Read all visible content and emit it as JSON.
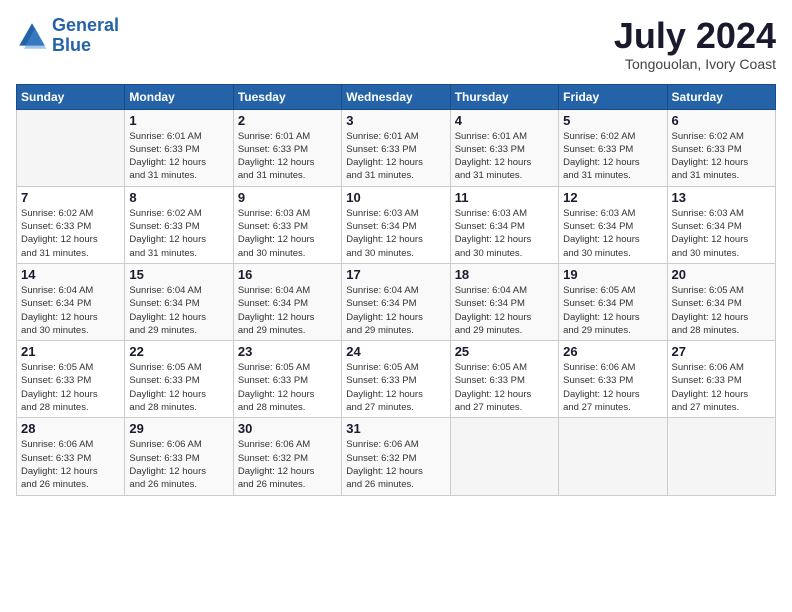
{
  "header": {
    "logo_line1": "General",
    "logo_line2": "Blue",
    "month_title": "July 2024",
    "subtitle": "Tongouolan, Ivory Coast"
  },
  "days_of_week": [
    "Sunday",
    "Monday",
    "Tuesday",
    "Wednesday",
    "Thursday",
    "Friday",
    "Saturday"
  ],
  "weeks": [
    [
      {
        "day": "",
        "info": ""
      },
      {
        "day": "1",
        "info": "Sunrise: 6:01 AM\nSunset: 6:33 PM\nDaylight: 12 hours\nand 31 minutes."
      },
      {
        "day": "2",
        "info": "Sunrise: 6:01 AM\nSunset: 6:33 PM\nDaylight: 12 hours\nand 31 minutes."
      },
      {
        "day": "3",
        "info": "Sunrise: 6:01 AM\nSunset: 6:33 PM\nDaylight: 12 hours\nand 31 minutes."
      },
      {
        "day": "4",
        "info": "Sunrise: 6:01 AM\nSunset: 6:33 PM\nDaylight: 12 hours\nand 31 minutes."
      },
      {
        "day": "5",
        "info": "Sunrise: 6:02 AM\nSunset: 6:33 PM\nDaylight: 12 hours\nand 31 minutes."
      },
      {
        "day": "6",
        "info": "Sunrise: 6:02 AM\nSunset: 6:33 PM\nDaylight: 12 hours\nand 31 minutes."
      }
    ],
    [
      {
        "day": "7",
        "info": "Sunrise: 6:02 AM\nSunset: 6:33 PM\nDaylight: 12 hours\nand 31 minutes."
      },
      {
        "day": "8",
        "info": "Sunrise: 6:02 AM\nSunset: 6:33 PM\nDaylight: 12 hours\nand 31 minutes."
      },
      {
        "day": "9",
        "info": "Sunrise: 6:03 AM\nSunset: 6:33 PM\nDaylight: 12 hours\nand 30 minutes."
      },
      {
        "day": "10",
        "info": "Sunrise: 6:03 AM\nSunset: 6:34 PM\nDaylight: 12 hours\nand 30 minutes."
      },
      {
        "day": "11",
        "info": "Sunrise: 6:03 AM\nSunset: 6:34 PM\nDaylight: 12 hours\nand 30 minutes."
      },
      {
        "day": "12",
        "info": "Sunrise: 6:03 AM\nSunset: 6:34 PM\nDaylight: 12 hours\nand 30 minutes."
      },
      {
        "day": "13",
        "info": "Sunrise: 6:03 AM\nSunset: 6:34 PM\nDaylight: 12 hours\nand 30 minutes."
      }
    ],
    [
      {
        "day": "14",
        "info": "Sunrise: 6:04 AM\nSunset: 6:34 PM\nDaylight: 12 hours\nand 30 minutes."
      },
      {
        "day": "15",
        "info": "Sunrise: 6:04 AM\nSunset: 6:34 PM\nDaylight: 12 hours\nand 29 minutes."
      },
      {
        "day": "16",
        "info": "Sunrise: 6:04 AM\nSunset: 6:34 PM\nDaylight: 12 hours\nand 29 minutes."
      },
      {
        "day": "17",
        "info": "Sunrise: 6:04 AM\nSunset: 6:34 PM\nDaylight: 12 hours\nand 29 minutes."
      },
      {
        "day": "18",
        "info": "Sunrise: 6:04 AM\nSunset: 6:34 PM\nDaylight: 12 hours\nand 29 minutes."
      },
      {
        "day": "19",
        "info": "Sunrise: 6:05 AM\nSunset: 6:34 PM\nDaylight: 12 hours\nand 29 minutes."
      },
      {
        "day": "20",
        "info": "Sunrise: 6:05 AM\nSunset: 6:34 PM\nDaylight: 12 hours\nand 28 minutes."
      }
    ],
    [
      {
        "day": "21",
        "info": "Sunrise: 6:05 AM\nSunset: 6:33 PM\nDaylight: 12 hours\nand 28 minutes."
      },
      {
        "day": "22",
        "info": "Sunrise: 6:05 AM\nSunset: 6:33 PM\nDaylight: 12 hours\nand 28 minutes."
      },
      {
        "day": "23",
        "info": "Sunrise: 6:05 AM\nSunset: 6:33 PM\nDaylight: 12 hours\nand 28 minutes."
      },
      {
        "day": "24",
        "info": "Sunrise: 6:05 AM\nSunset: 6:33 PM\nDaylight: 12 hours\nand 27 minutes."
      },
      {
        "day": "25",
        "info": "Sunrise: 6:05 AM\nSunset: 6:33 PM\nDaylight: 12 hours\nand 27 minutes."
      },
      {
        "day": "26",
        "info": "Sunrise: 6:06 AM\nSunset: 6:33 PM\nDaylight: 12 hours\nand 27 minutes."
      },
      {
        "day": "27",
        "info": "Sunrise: 6:06 AM\nSunset: 6:33 PM\nDaylight: 12 hours\nand 27 minutes."
      }
    ],
    [
      {
        "day": "28",
        "info": "Sunrise: 6:06 AM\nSunset: 6:33 PM\nDaylight: 12 hours\nand 26 minutes."
      },
      {
        "day": "29",
        "info": "Sunrise: 6:06 AM\nSunset: 6:33 PM\nDaylight: 12 hours\nand 26 minutes."
      },
      {
        "day": "30",
        "info": "Sunrise: 6:06 AM\nSunset: 6:32 PM\nDaylight: 12 hours\nand 26 minutes."
      },
      {
        "day": "31",
        "info": "Sunrise: 6:06 AM\nSunset: 6:32 PM\nDaylight: 12 hours\nand 26 minutes."
      },
      {
        "day": "",
        "info": ""
      },
      {
        "day": "",
        "info": ""
      },
      {
        "day": "",
        "info": ""
      }
    ]
  ]
}
